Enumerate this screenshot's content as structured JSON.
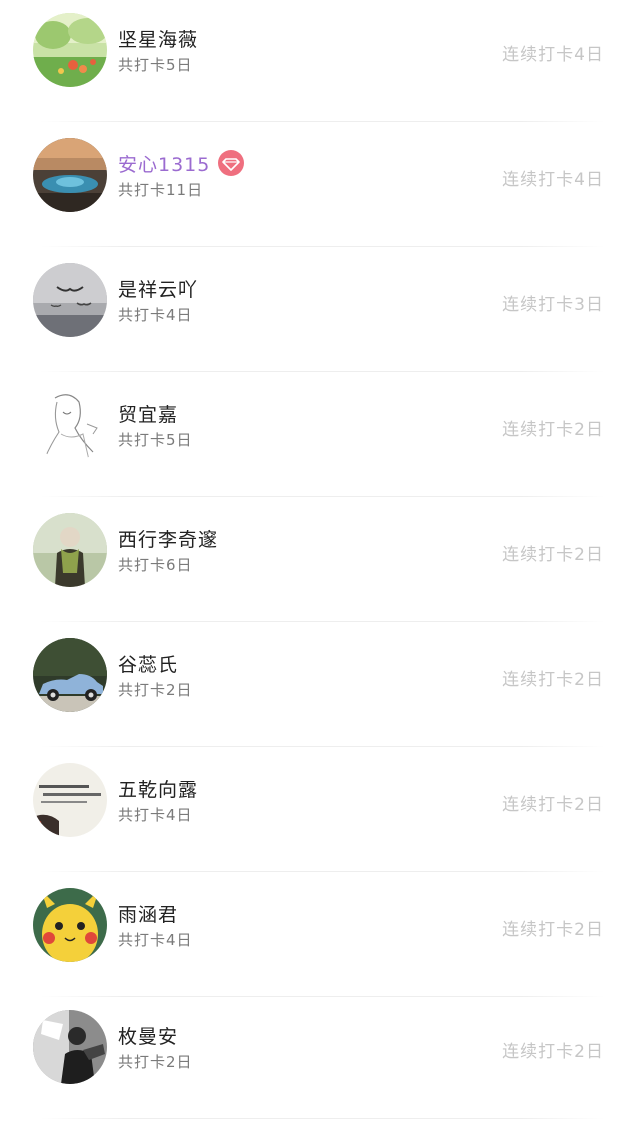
{
  "rows": [
    {
      "name": "坚星海薇",
      "total": "共打卡5日",
      "streak": "连续打卡4日",
      "avatar_icon": "garden-flowers-avatar"
    },
    {
      "name": "安心1315",
      "total": "共打卡11日",
      "streak": "连续打卡4日",
      "avatar_icon": "lake-sunset-avatar",
      "vip": true,
      "name_color": "#9b6bd0",
      "badge_color": "#ef6f7f",
      "badge_icon": "diamond-icon"
    },
    {
      "name": "是祥云吖",
      "total": "共打卡4日",
      "streak": "连续打卡3日",
      "avatar_icon": "birds-sky-avatar"
    },
    {
      "name": "贸宜嘉",
      "total": "共打卡5日",
      "streak": "连续打卡2日",
      "avatar_icon": "sketch-girl-avatar"
    },
    {
      "name": "西行李奇邃",
      "total": "共打卡6日",
      "streak": "连续打卡2日",
      "avatar_icon": "person-scarf-avatar"
    },
    {
      "name": "谷蕊氏",
      "total": "共打卡2日",
      "streak": "连续打卡2日",
      "avatar_icon": "vintage-car-avatar"
    },
    {
      "name": "五乾向露",
      "total": "共打卡4日",
      "streak": "连续打卡2日",
      "avatar_icon": "text-quote-avatar"
    },
    {
      "name": "雨涵君",
      "total": "共打卡4日",
      "streak": "连续打卡2日",
      "avatar_icon": "pikachu-avatar"
    },
    {
      "name": "枚曼安",
      "total": "共打卡2日",
      "streak": "连续打卡2日",
      "avatar_icon": "bw-photo-avatar"
    }
  ]
}
